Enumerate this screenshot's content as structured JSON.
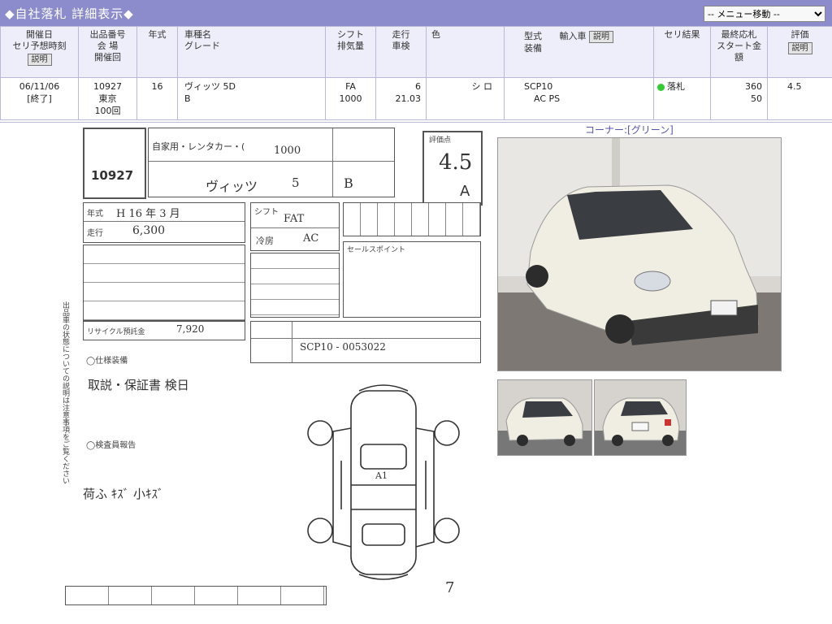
{
  "header": {
    "title": "◆自社落札 詳細表示◆",
    "menu_select": "-- メニュー移動 --"
  },
  "columns": {
    "c1": [
      "開催日",
      "セリ予想時刻"
    ],
    "c1_btn": "説明",
    "c2": [
      "出品番号",
      "会 場",
      "開催回"
    ],
    "c3": "年式",
    "c4": [
      "車種名",
      "グレード"
    ],
    "c5": [
      "シフト",
      "排気量"
    ],
    "c6": [
      "走行",
      "車検"
    ],
    "c7": "色",
    "c8": [
      "型式",
      "装備"
    ],
    "c8_label": "輸入車",
    "c8_btn": "説明",
    "c9": "セリ結果",
    "c10": [
      "最終応札",
      "スタート金額"
    ],
    "c11": "評価",
    "c11_btn": "説明"
  },
  "row": {
    "date": "06/11/06",
    "date_status": "[終了]",
    "lot_no": "10927",
    "venue": "東京",
    "session": "100回",
    "year": "16",
    "model": "ヴィッツ 5D",
    "grade": "B",
    "shift": "FA",
    "cc": "1000",
    "mileage": "6",
    "inspection": "21.03",
    "color": "シ ロ",
    "type": "SCP10",
    "equipment": "AC PS",
    "result": "落札",
    "final_bid": "360",
    "start_price": "50",
    "score": "4.5"
  },
  "sheet": {
    "lot_no": "10927",
    "usage": "自家用・レンタカー・(",
    "displacement": "1000",
    "model_hw": "ヴィッツ",
    "doors": "5",
    "grade": "B",
    "score_label": "評価点",
    "score_hw": "4.5",
    "interior": "A",
    "year_hw": "H 16 年 3 月",
    "mileage_hw": "6,300",
    "shift_hw": "FAT",
    "ac_hw": "AC",
    "recycle_hw": "7,920",
    "vin_hw": "SCP10 - 0053022",
    "notes_hw": "取説・保証書 検日",
    "comment_hw": "荷ふ ｷｽﾞ 小ｷｽﾞ",
    "condition_mark": "A1",
    "page_no": "7",
    "vertical_text": "出品車の状態についての説明は注意事項をご覧ください",
    "labels": {
      "mileage": "走行",
      "year": "年式",
      "shift": "シフト",
      "ac": "冷房",
      "equip": "装備",
      "recycle": "リサイクル預託金",
      "sales_point": "セールスポイント",
      "options": "◯仕様装備",
      "inspect": "◯検査員報告"
    }
  },
  "photos": {
    "corner_label": "コーナー:[グリーン]"
  }
}
